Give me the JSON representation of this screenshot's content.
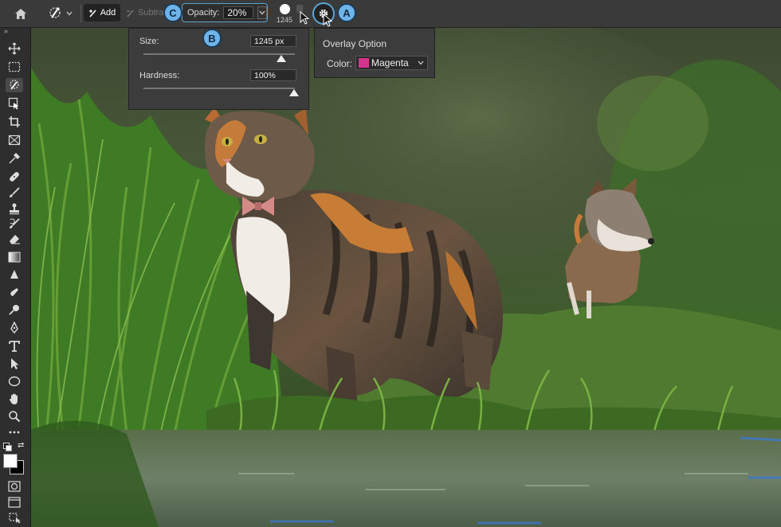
{
  "options_bar": {
    "add_label": "Add",
    "subtract_label": "Subtra",
    "opacity_label": "Opacity:",
    "opacity_value": "20%",
    "brush_size_preview": "1245"
  },
  "callouts": {
    "a": "A",
    "b": "B",
    "c": "C"
  },
  "brush_panel": {
    "size_label": "Size:",
    "size_value": "1245 px",
    "size_slider_fraction": 0.92,
    "hardness_label": "Hardness:",
    "hardness_value": "100%",
    "hardness_slider_fraction": 1.0
  },
  "overlay_panel": {
    "title": "Overlay Option",
    "color_label": "Color:",
    "color_value": "Magenta",
    "color_swatch": "#d6338f"
  },
  "colors": {
    "accent": "#5da4d6",
    "callout_fill": "#6cb4ea"
  },
  "icons": {
    "toolbar": [
      "move-icon",
      "marquee-icon",
      "quick-select-icon",
      "object-select-icon",
      "crop-icon",
      "frame-icon",
      "eyedropper-icon",
      "healing-icon",
      "brush-icon",
      "stamp-icon",
      "history-brush-icon",
      "eraser-icon",
      "gradient-icon",
      "blur-icon",
      "smudge-icon",
      "dodge-icon",
      "pen-icon",
      "type-icon",
      "path-select-icon",
      "ellipse-icon",
      "hand-icon",
      "zoom-icon",
      "more-icon"
    ]
  }
}
